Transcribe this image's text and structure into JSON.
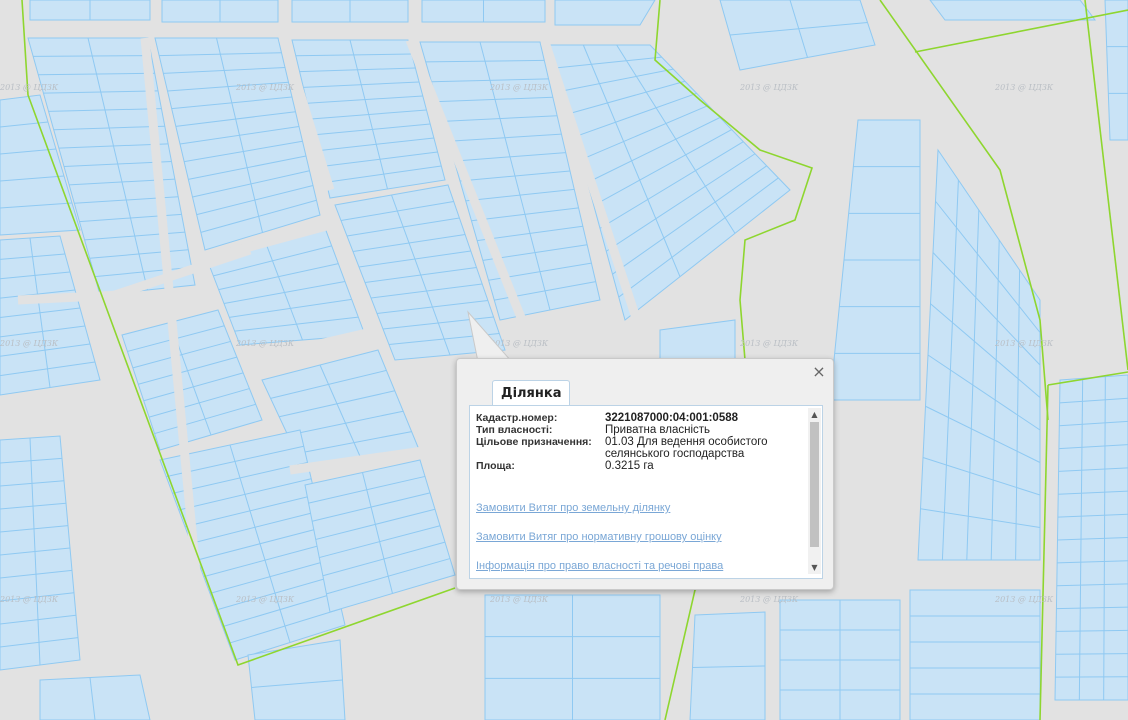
{
  "map": {
    "watermark_text": "2013 @ ЦДЗК",
    "colors": {
      "background": "#e2e2e2",
      "parcel_fill": "#c9e3f6",
      "parcel_stroke": "#8fc9f2",
      "boundary": "#8ed62f"
    }
  },
  "popup": {
    "tab_label": "Ділянка",
    "fields": [
      {
        "label": "Кадастр.номер:",
        "value": "3221087000:04:001:0588"
      },
      {
        "label": "Тип власності:",
        "value": "Приватна власність"
      },
      {
        "label": "Цільове призначення:",
        "value": "01.03 Для ведення особистого селянського господарства"
      },
      {
        "label": "Площа:",
        "value": "0.3215 га"
      }
    ],
    "links": [
      "Замовити Витяг про земельну ділянку",
      "Замовити Витяг про нормативну грошову оцінку",
      "Інформація про право власності та речові права"
    ],
    "close_symbol": "×"
  }
}
